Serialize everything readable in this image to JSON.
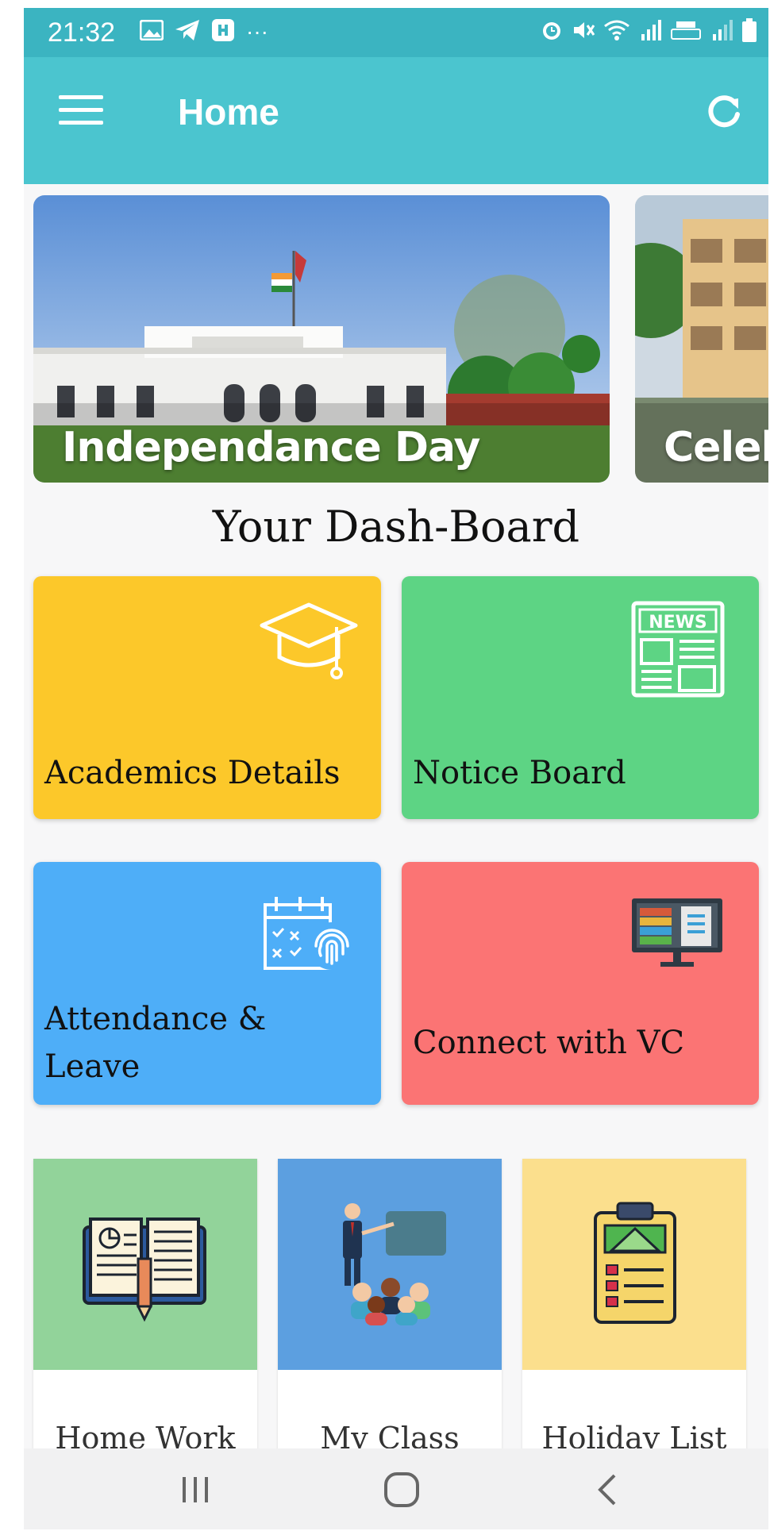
{
  "status_bar": {
    "time": "21:32"
  },
  "app_bar": {
    "title": "Home"
  },
  "carousel": {
    "slides": [
      {
        "caption": "Independance Day"
      },
      {
        "caption": "Celeb"
      }
    ]
  },
  "dashboard": {
    "title": "Your Dash-Board",
    "tiles": [
      {
        "label": "Academics Details",
        "color": "#fcc82a",
        "icon": "graduation-cap-icon"
      },
      {
        "label": "Notice Board",
        "color": "#5dd484",
        "icon": "newspaper-icon"
      },
      {
        "label": "Attendance &",
        "label2": "Leave",
        "color": "#4eaef8",
        "icon": "attendance-fingerprint-icon"
      },
      {
        "label": "Connect with VC",
        "color": "#fb7474",
        "icon": "monitor-books-icon"
      }
    ],
    "cards": [
      {
        "label": "Home Work",
        "color": "#92d39a",
        "icon": "open-book-pencil-icon"
      },
      {
        "label": "My Class",
        "color": "#5c9fe0",
        "icon": "teacher-class-icon"
      },
      {
        "label": "Holiday List",
        "color": "#fbdf8d",
        "icon": "clipboard-checklist-icon"
      }
    ]
  }
}
